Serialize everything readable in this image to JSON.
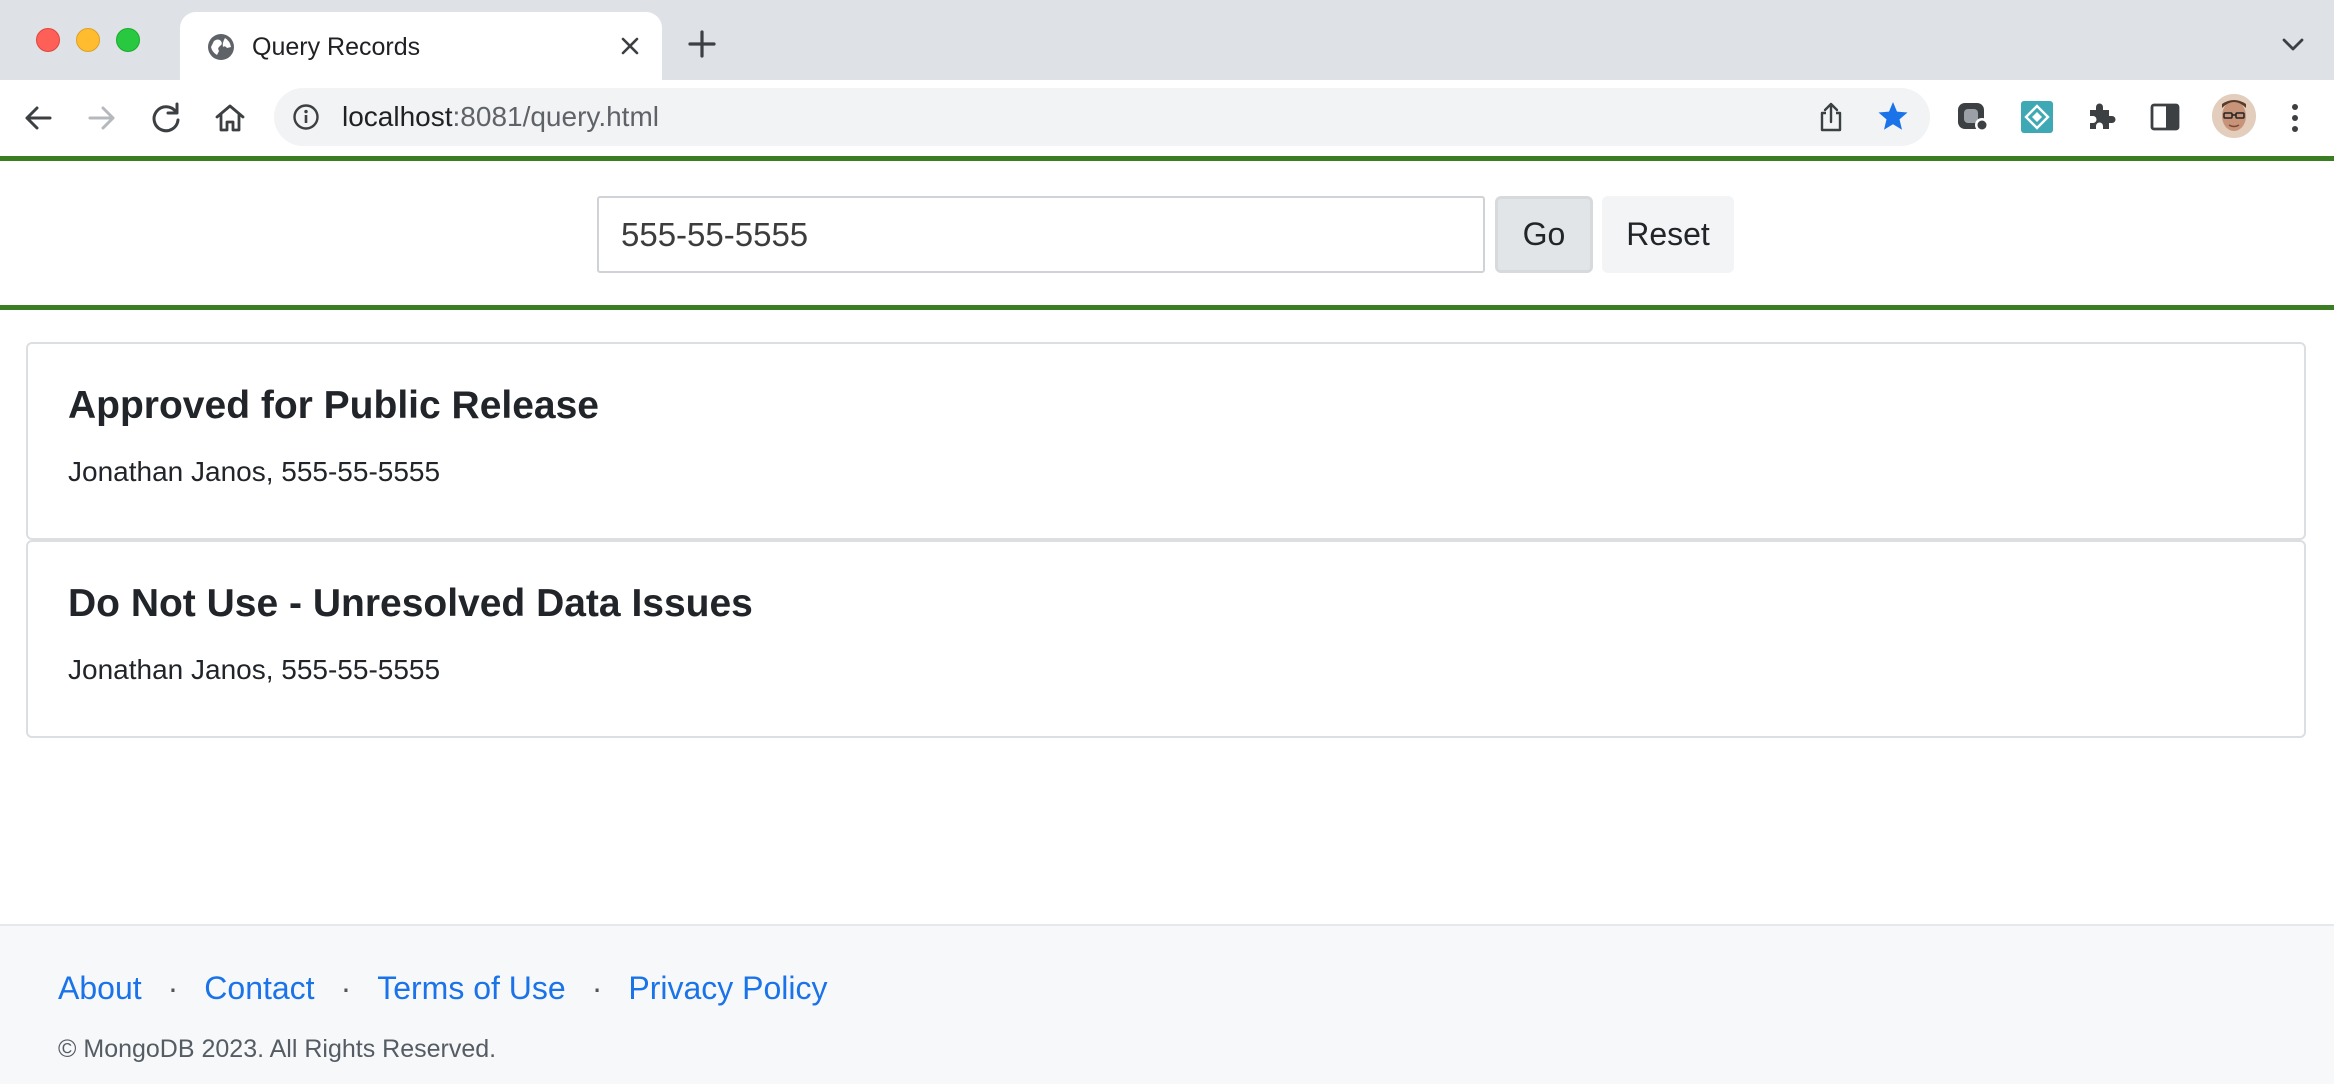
{
  "browser": {
    "tab_title": "Query Records",
    "url_host": "localhost",
    "url_rest": ":8081/query.html",
    "icons": {
      "favicon": "globe-icon",
      "tab_close": "close-icon",
      "new_tab": "plus-icon",
      "tab_menu": "chevron-down-icon",
      "back": "arrow-left-icon",
      "forward": "arrow-right-icon",
      "reload": "reload-icon",
      "home": "home-icon",
      "site_info": "info-icon",
      "share": "share-icon",
      "bookmark": "star-icon",
      "extensions": "puzzle-icon",
      "side_panel": "side-panel-icon",
      "menu": "kebab-menu-icon"
    },
    "colors": {
      "tabbar": "#dee1e6",
      "bookmark_star": "#1a73e8"
    }
  },
  "search": {
    "value": "555-55-5555",
    "go_label": "Go",
    "reset_label": "Reset"
  },
  "results": [
    {
      "title": "Approved for Public Release",
      "text": "Jonathan Janos, 555-55-5555"
    },
    {
      "title": "Do Not Use - Unresolved Data Issues",
      "text": "Jonathan Janos, 555-55-5555"
    }
  ],
  "footer": {
    "links": [
      "About",
      "Contact",
      "Terms of Use",
      "Privacy Policy"
    ],
    "separator": "·",
    "copyright": "© MongoDB 2023. All Rights Reserved."
  },
  "theme": {
    "accent_green": "#3b7d23",
    "link_blue": "#1a73e8"
  }
}
